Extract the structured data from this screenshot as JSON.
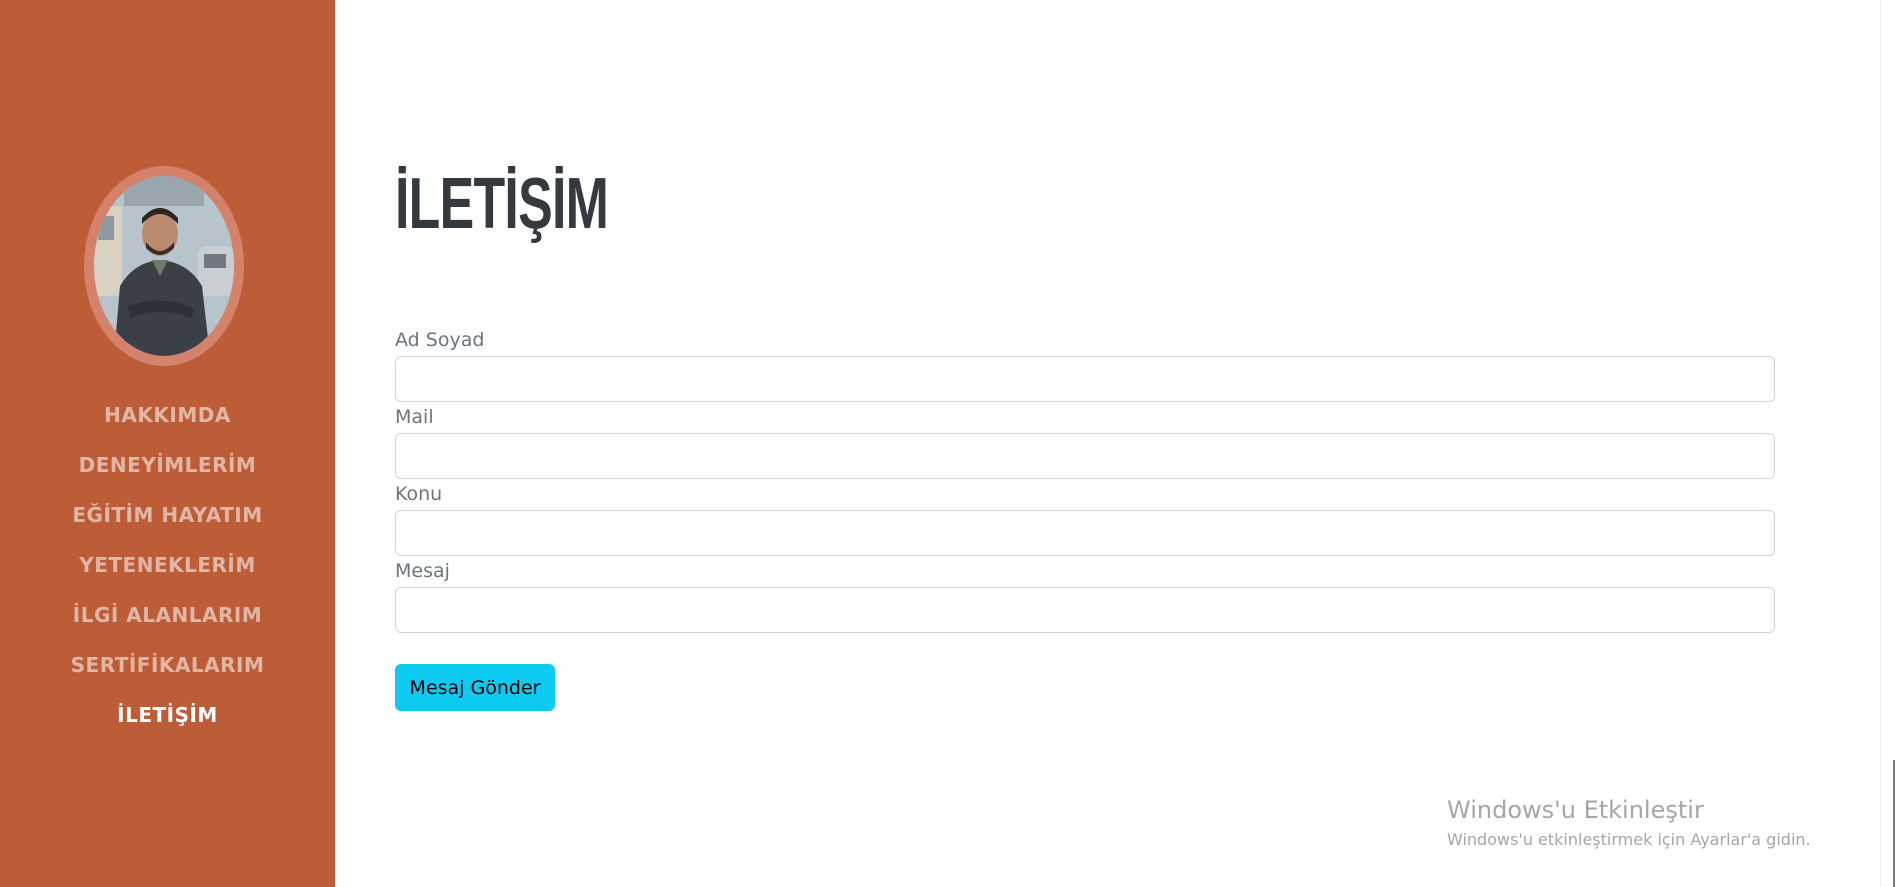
{
  "sidebar": {
    "bg_color": "#bd5d38",
    "nav": [
      {
        "label": "HAKKIMDA",
        "active": false
      },
      {
        "label": "DENEYİMLERİM",
        "active": false
      },
      {
        "label": "EĞİTİM HAYATIM",
        "active": false
      },
      {
        "label": "YETENEKLERİM",
        "active": false
      },
      {
        "label": "İLGİ ALANLARIM",
        "active": false
      },
      {
        "label": "SERTİFİKALARIM",
        "active": false
      },
      {
        "label": "İLETİŞİM",
        "active": true
      }
    ]
  },
  "main": {
    "title": "İLETİŞİM",
    "form": {
      "fields": [
        {
          "label": "Ad Soyad",
          "value": ""
        },
        {
          "label": "Mail",
          "value": ""
        },
        {
          "label": "Konu",
          "value": ""
        },
        {
          "label": "Mesaj",
          "value": ""
        }
      ],
      "submit_label": "Mesaj Gönder",
      "submit_color": "#0dcaf0"
    }
  },
  "watermark": {
    "title": "Windows'u Etkinleştir",
    "subtitle": "Windows'u etkinleştirmek için Ayarlar'a gidin."
  }
}
